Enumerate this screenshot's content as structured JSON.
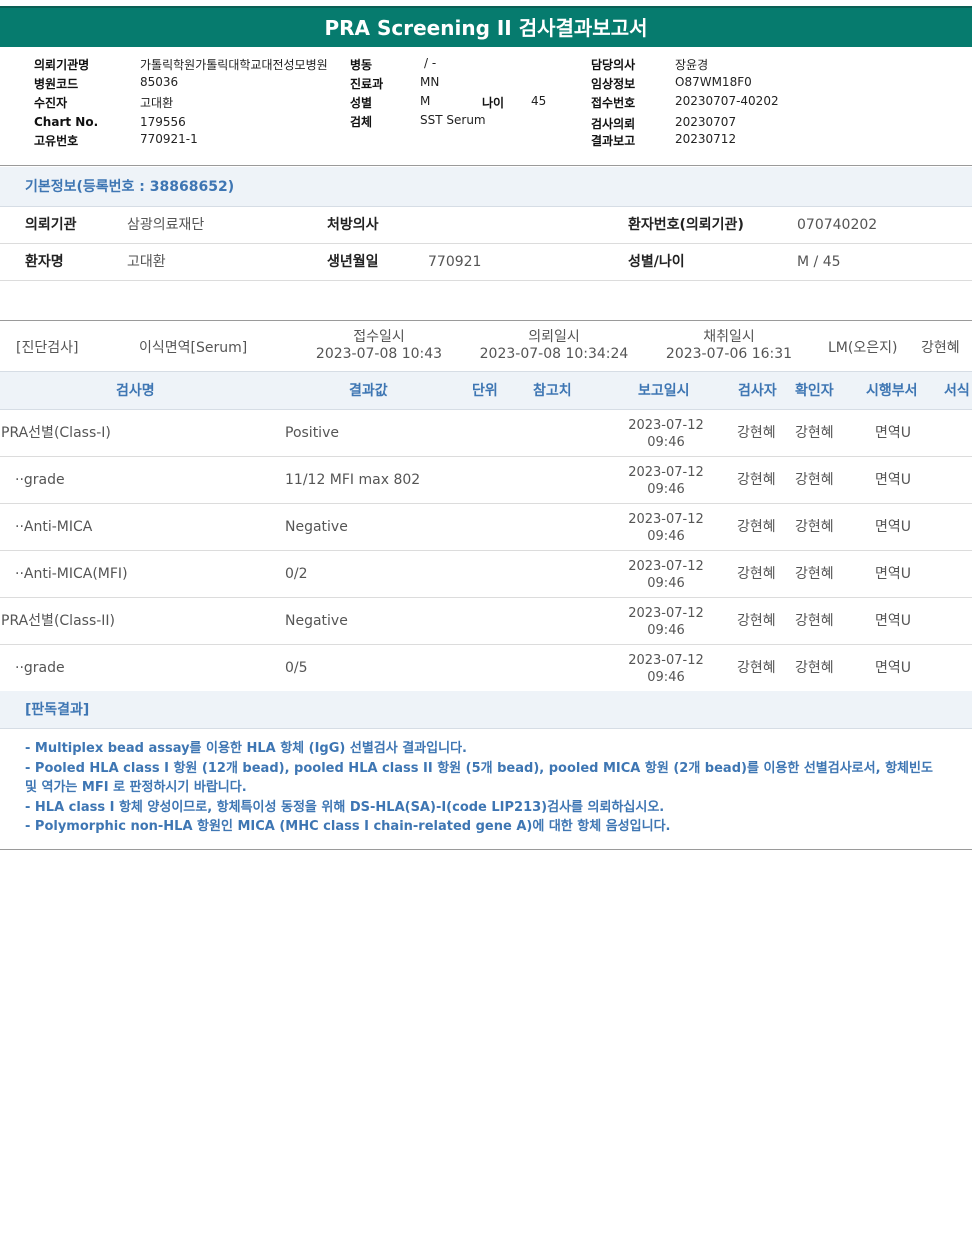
{
  "title": "PRA Screening II 검사결과보고서",
  "header": {
    "requesting_org_label": "의뢰기관명",
    "requesting_org": "가톨릭학원가톨릭대학교대전성모병원",
    "hospital_code_label": "병원코드",
    "hospital_code": "85036",
    "patient_label": "수진자",
    "patient": "고대환",
    "chart_no_label": "Chart No.",
    "chart_no": "179556",
    "unique_no_label": "고유번호",
    "unique_no": "770921-1",
    "ward_label": "병동",
    "ward": "/ -",
    "department_label": "진료과",
    "department": "MN",
    "sex_label": "성별",
    "sex": "M",
    "age_label": "나이",
    "age": "45",
    "specimen_label": "검체",
    "specimen": "SST Serum",
    "doctor_label": "담당의사",
    "doctor": "장윤경",
    "clinical_info_label": "임상정보",
    "clinical_info": "O87WM18F0",
    "receipt_no_label": "접수번호",
    "receipt_no": "20230707-40202",
    "test_request_label": "검사의뢰",
    "test_request": "20230707",
    "result_report_label": "결과보고",
    "result_report": "20230712"
  },
  "basic_info": {
    "title": "기본정보(등록번호 : 38868652)",
    "org_label": "의뢰기관",
    "org": "삼광의료재단",
    "prescriber_label": "처방의사",
    "prescriber": "",
    "patient_no_label": "환자번호(의뢰기관)",
    "patient_no": "070740202",
    "patient_name_label": "환자명",
    "patient_name": "고대환",
    "birth_label": "생년월일",
    "birth": "770921",
    "sex_age_label": "성별/나이",
    "sex_age": "M / 45"
  },
  "order": {
    "category": "[진단검사]",
    "test_name": "이식면역[Serum]",
    "receipt_label": "접수일시",
    "receipt_time": "2023-07-08 10:43",
    "request_label": "의뢰일시",
    "request_time": "2023-07-08 10:34:24",
    "collect_label": "채취일시",
    "collect_time": "2023-07-06 16:31",
    "lab": "LM(오은지)",
    "person": "강현혜"
  },
  "table": {
    "headers": {
      "name": "검사명",
      "result": "결과값",
      "unit": "단위",
      "ref": "참고치",
      "report_date": "보고일시",
      "tester": "검사자",
      "confirmer": "확인자",
      "dept": "시행부서",
      "format": "서식"
    },
    "rows": [
      {
        "name": "PRA선별(Class-I)",
        "result": "Positive",
        "date": "2023-07-12",
        "time": "09:46",
        "tester": "강현혜",
        "confirmer": "강현혜",
        "dept": "면역U"
      },
      {
        "name": "··grade",
        "result": "11/12 MFI max 802",
        "date": "2023-07-12",
        "time": "09:46",
        "tester": "강현혜",
        "confirmer": "강현혜",
        "dept": "면역U"
      },
      {
        "name": "··Anti-MICA",
        "result": "Negative",
        "date": "2023-07-12",
        "time": "09:46",
        "tester": "강현혜",
        "confirmer": "강현혜",
        "dept": "면역U"
      },
      {
        "name": "··Anti-MICA(MFI)",
        "result": "0/2",
        "date": "2023-07-12",
        "time": "09:46",
        "tester": "강현혜",
        "confirmer": "강현혜",
        "dept": "면역U"
      },
      {
        "name": "PRA선별(Class-II)",
        "result": "Negative",
        "date": "2023-07-12",
        "time": "09:46",
        "tester": "강현혜",
        "confirmer": "강현혜",
        "dept": "면역U"
      },
      {
        "name": "··grade",
        "result": "0/5",
        "date": "2023-07-12",
        "time": "09:46",
        "tester": "강현혜",
        "confirmer": "강현혜",
        "dept": "면역U"
      }
    ]
  },
  "interpretation": {
    "title": "[판독결과]",
    "lines": [
      "- Multiplex bead assay를 이용한 HLA 항체 (IgG) 선별검사 결과입니다.",
      "- Pooled HLA class I 항원 (12개 bead), pooled HLA class II 항원 (5개 bead), pooled MICA 항원 (2개 bead)를 이용한 선별검사로서, 항체빈도 및 역가는 MFI 로 판정하시기 바랍니다.",
      "- HLA class I 항체 양성이므로, 항체특이성 동정을 위해 DS-HLA(SA)-I(code LIP213)검사를 의뢰하십시오.",
      "- Polymorphic non-HLA 항원인 MICA (MHC class I chain-related gene A)에 대한 항체 음성입니다."
    ]
  }
}
